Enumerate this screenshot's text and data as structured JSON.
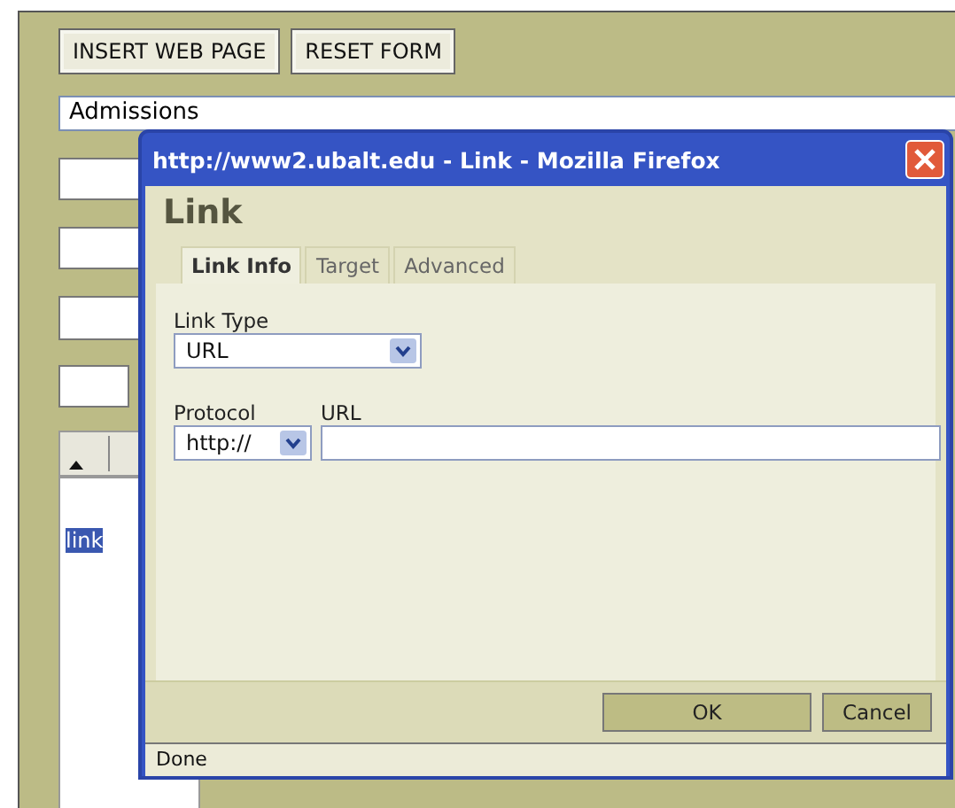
{
  "page": {
    "buttons": [
      "INSERT WEB PAGE",
      "RESET FORM"
    ],
    "title_field": {
      "value": "Admissions"
    },
    "editor": {
      "selected_text": "link"
    }
  },
  "dialog": {
    "title": "http://www2.ubalt.edu - Link - Mozilla Firefox",
    "heading": "Link",
    "tabs": [
      {
        "label": "Link Info",
        "selected": true
      },
      {
        "label": "Target",
        "selected": false
      },
      {
        "label": "Advanced",
        "selected": false
      }
    ],
    "link_type": {
      "label": "Link Type",
      "value": "URL"
    },
    "protocol": {
      "label": "Protocol",
      "value": "http://"
    },
    "url": {
      "label": "URL"
    },
    "buttons": [
      "OK",
      "Cancel"
    ],
    "status_bar": "Done"
  }
}
